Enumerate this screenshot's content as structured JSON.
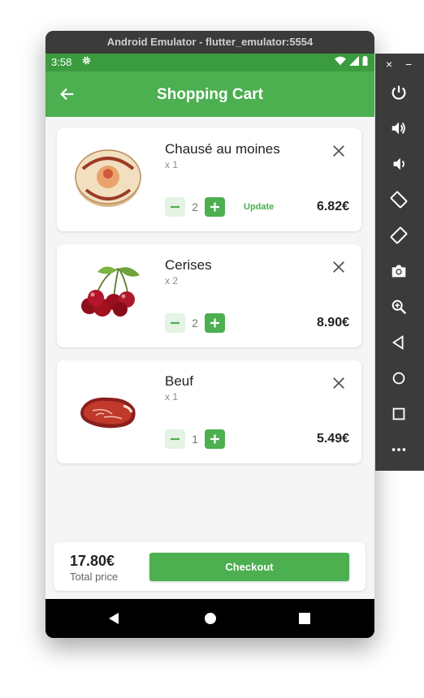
{
  "emulator": {
    "title": "Android Emulator - flutter_emulator:5554",
    "side_close": "×",
    "side_minimize": "−",
    "side_buttons": [
      "power-icon",
      "volume-up-icon",
      "volume-down-icon",
      "rotate-left-icon",
      "rotate-right-icon",
      "camera-icon",
      "zoom-icon",
      "back-icon",
      "home-icon",
      "overview-icon",
      "more-icon"
    ]
  },
  "status_bar": {
    "time": "3:58"
  },
  "app_bar": {
    "title": "Shopping Cart"
  },
  "cart": {
    "items": [
      {
        "name": "Chausé au moines",
        "qty_label": "x 1",
        "count": "2",
        "update_label": "Update",
        "price": "6.82€",
        "image": "cheese-image"
      },
      {
        "name": "Cerises",
        "qty_label": "x 2",
        "count": "2",
        "update_label": "",
        "price": "8.90€",
        "image": "cherries-image"
      },
      {
        "name": "Beuf",
        "qty_label": "x 1",
        "count": "1",
        "update_label": "",
        "price": "5.49€",
        "image": "beef-image"
      }
    ]
  },
  "footer": {
    "total": "17.80€",
    "total_label": "Total price",
    "checkout_label": "Checkout"
  },
  "colors": {
    "primary": "#4caf50",
    "status_bar": "#3a9c3e",
    "background": "#f5f5f5",
    "light_green": "#e4f3e4"
  }
}
